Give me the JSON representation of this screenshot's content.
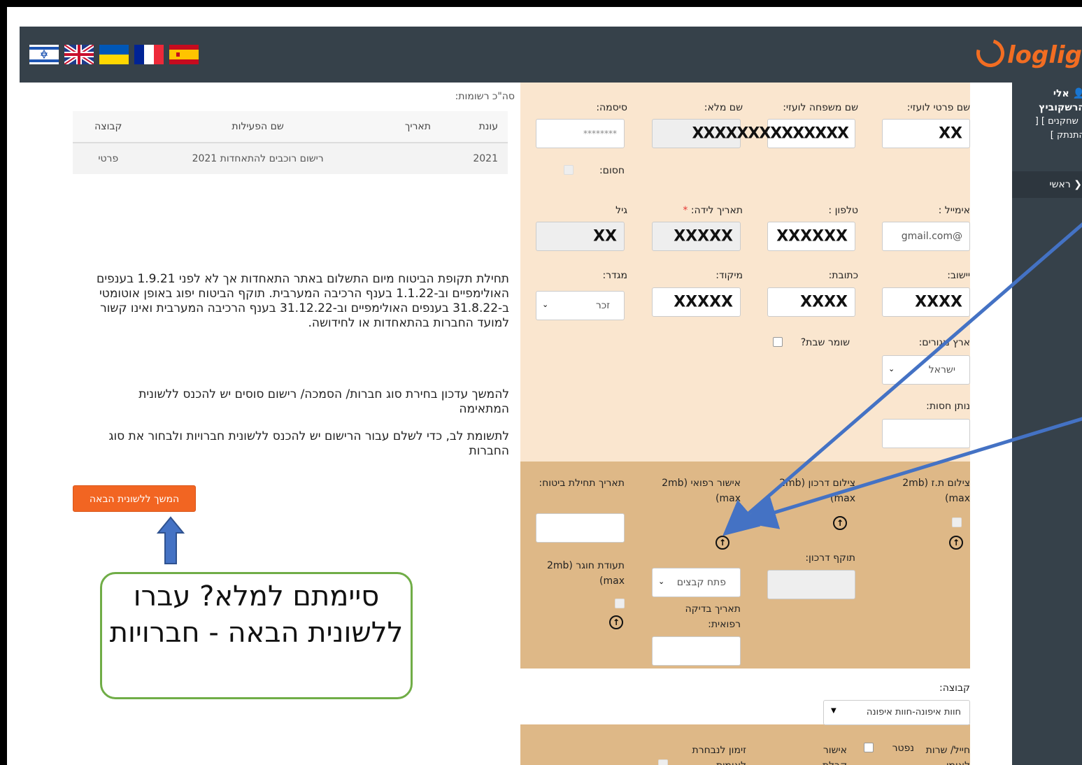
{
  "header": {
    "logo": "loglig",
    "flags": [
      "flag-israel",
      "flag-uk",
      "flag-ukraine",
      "flag-france",
      "flag-spain"
    ]
  },
  "sidebar": {
    "user_name": "אלי הרשקוביץ",
    "links": "[ שחקנים ] [ התנתק ]",
    "home": "ראשי"
  },
  "records": {
    "count_label": "סה\"כ רשומות:",
    "headers": [
      "עונת",
      "תאריך",
      "שם הפעילות",
      "קבוצה"
    ],
    "rows": [
      [
        "2021",
        "",
        "רישום רוכבים להתאחדות 2021",
        "פרטי"
      ]
    ]
  },
  "info": {
    "p1": "תחילת תקופת הביטוח מיום התשלום באתר התאחדות אך לא לפני 1.9.21 בענפים האולימפיים וב-1.1.22 בענף הרכיבה המערבית. תוקף הביטוח יפוג באופן אוטומטי ב-31.8.22 בענפים האולימפיים וב-31.12.22 בענף הרכיבה המערבית ואינו קשור למועד החברות בהתאחדות או לחידושה.",
    "p2": "להמשך עדכון בחירת סוג חברות/ הסמכה/ רישום סוסים יש להכנס ללשונית המתאימה",
    "p3": "לתשומת לב, כדי לשלם עבור הרישום יש להכנס ללשונית חברויות ולבחור את סוג החברות",
    "next_button": "המשך ללשונית הבאה"
  },
  "callout": {
    "text": "סיימתם למלא? עברו ללשונית הבאה - חברויות"
  },
  "form": {
    "first_name_label": "שם פרטי לועזי:",
    "first_name_value": "XX",
    "last_name_label": "שם משפחה לועזי:",
    "full_name_label": "שם מלא:",
    "full_name_value": "XXXXXXXXXXXXXX",
    "password_label": "סיסמה:",
    "password_value": "********",
    "blocked_label": "חסום:",
    "email_label": "אימייל :",
    "email_value": "@gmail.com",
    "phone_label": "טלפון :",
    "phone_value": "XXXXXX",
    "birth_label": "תאריך לידה:",
    "birth_value": "XXXXX",
    "age_label": "גיל",
    "age_value": "XX",
    "city_label": "יישוב:",
    "city_value": "XXXX",
    "address_label": "כתובת:",
    "address_value": "XXXX",
    "zip_label": "מיקוד:",
    "zip_value": "XXXXX",
    "gender_label": "מגדר:",
    "gender_value": "זכר",
    "country_label": "ארץ מגורים:",
    "country_value": "ישראל",
    "shabbat_label": "שומר שבת?",
    "club_label": "נותן חסות:",
    "id_photo_label": "צילום ת.ז (2mb max)",
    "passport_label": "צילום דרכון (2mb max)",
    "medical_label": "אישור רפואי (2mb max)",
    "insurance_start_label": "תאריך תחילת ביטוח:",
    "passport_expiry_label": "תוקף דרכון:",
    "medical_date_label": "תאריך בדיקה רפואית:",
    "file_select": "פתח קבצים",
    "circular_label": "תעודת חוגר (2mb max)",
    "group_label": "קבוצה:",
    "group_value": "חוות איפונה-חוות איפונה",
    "soldier_label": "חייל/ שרות לאומי",
    "deceased_label": "נפטר",
    "permit_label": "אישור קבלת דיוור",
    "national_label": "זימון לנבחרת לאומית"
  }
}
